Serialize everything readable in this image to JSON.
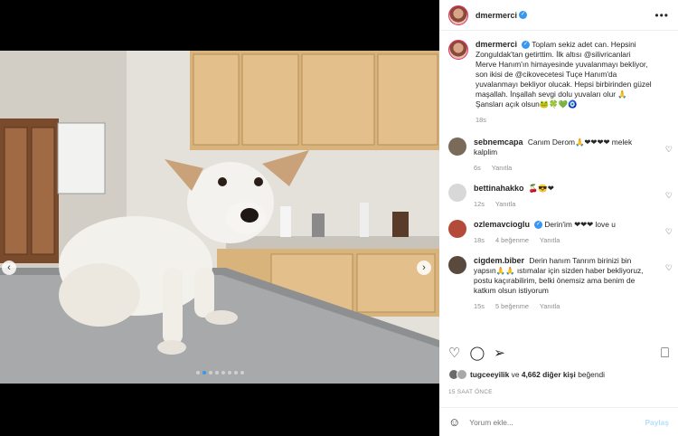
{
  "post": {
    "username": "dmermerci",
    "caption_user": "dmermerci",
    "caption": "Toplam sekiz adet can. Hepsini Zonguldak'tan getirttim. İlk altısı @silivricanlari Merve Hanım'ın himayesinde yuvalanmayı bekliyor, son ikisi de @cikovecetesi Tuçe Hanım'da yuvalanmayı bekliyor olucak. Hepsi birbirinden güzel maşallah. İnşallah sevgi dolu yuvaları olur 🙏 Şansları açık olsun🐸🍀💚🧿",
    "caption_time": "18s",
    "more": "•••"
  },
  "comments": [
    {
      "user": "sebnemcapa",
      "text": "Canım Derom🙏❤❤❤❤ melek kalplim",
      "time": "6s",
      "reply": "Yanıtla",
      "likes": ""
    },
    {
      "user": "bettinahakko",
      "text": "🍒😎❤",
      "time": "12s",
      "reply": "Yanıtla",
      "likes": ""
    },
    {
      "user": "ozlemavcioglu",
      "text": "Derin'im ❤❤❤ love u",
      "time": "18s",
      "reply": "Yanıtla",
      "likes": "4 beğenme"
    },
    {
      "user": "cigdem.biber",
      "text": "Derin hanım Tanrım birinizi bin yapsın🙏🙏 ıstımalar için sizden haber bekliyoruz, postu kaçırabilirim, belki önemsiz ama benim de katkım olsun istiyorum",
      "time": "15s",
      "reply": "Yanıtla",
      "likes": "5 beğenme"
    }
  ],
  "likes": {
    "user": "tugceeyilik",
    "connector": "ve",
    "count": "4,662 diğer kişi",
    "suffix": "beğendi"
  },
  "time_ago": "15 SAAT ÖNCE",
  "add_comment": {
    "placeholder": "Yorum ekle...",
    "post_label": "Paylaş"
  },
  "icons": {
    "prev": "chevron-left-icon",
    "next": "chevron-right-icon",
    "heart": "heart-icon",
    "comment": "comment-icon",
    "share": "share-icon",
    "save": "bookmark-icon",
    "emoji": "emoji-icon"
  },
  "carousel": {
    "count": 8,
    "active": 1
  },
  "colors": {
    "accent": "#3897f0",
    "link": "#00376b",
    "muted": "#8e8e8e"
  }
}
